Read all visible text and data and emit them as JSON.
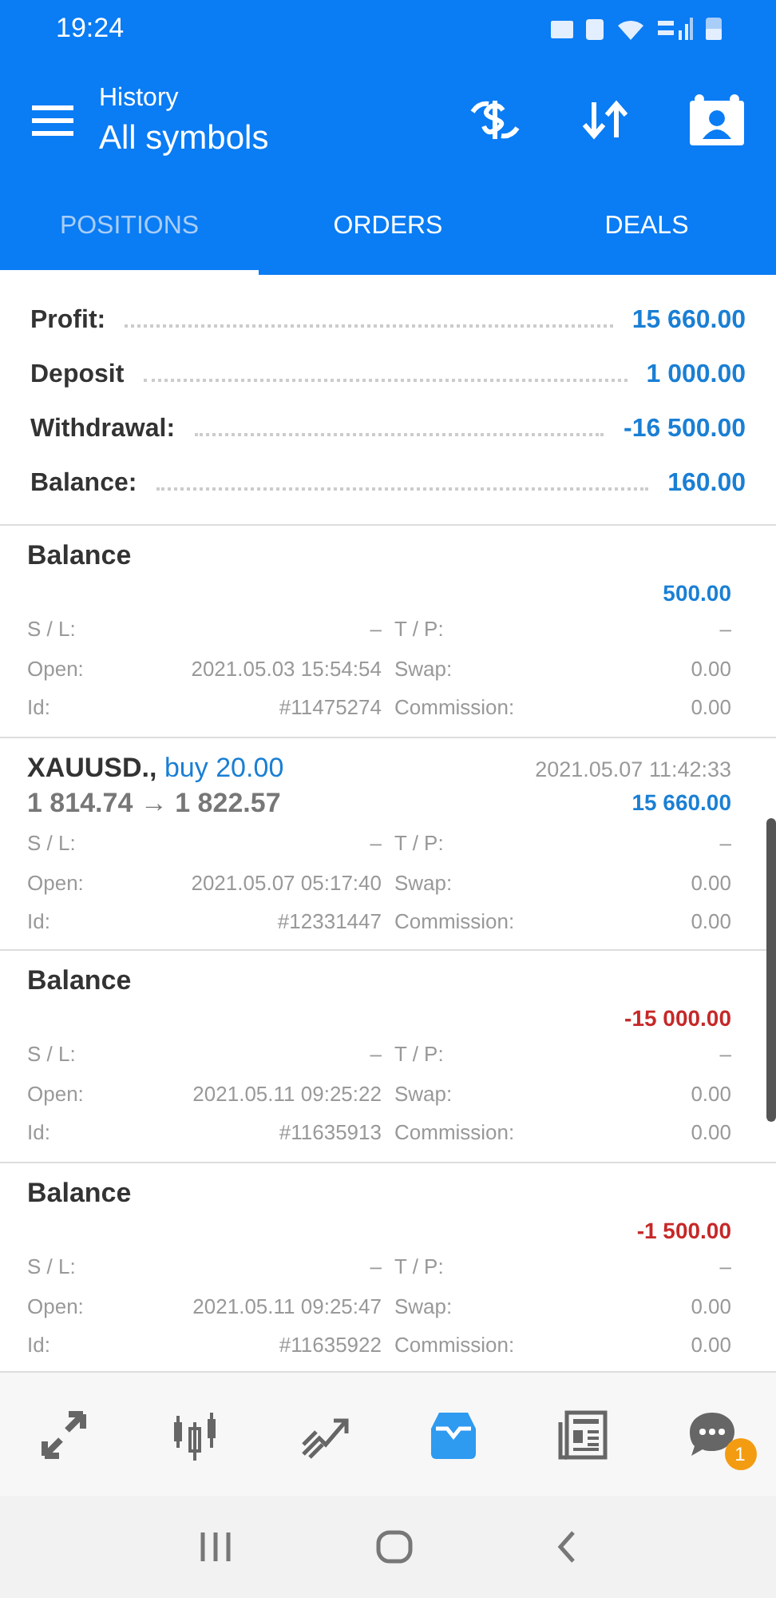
{
  "status_bar": {
    "time": "19:24"
  },
  "toolbar": {
    "subtitle": "History",
    "title": "All symbols"
  },
  "tabs": [
    {
      "label": "POSITIONS",
      "selected": true
    },
    {
      "label": "ORDERS",
      "selected": false
    },
    {
      "label": "DEALS",
      "selected": false
    }
  ],
  "summary": [
    {
      "label": "Profit:",
      "value": "15 660.00"
    },
    {
      "label": "Deposit",
      "value": "1 000.00"
    },
    {
      "label": "Withdrawal:",
      "value": "-16 500.00"
    },
    {
      "label": "Balance:",
      "value": "160.00"
    }
  ],
  "deals": [
    {
      "kind": "balance",
      "title": "Balance",
      "amount": "500.00",
      "color": "#1a7fd4",
      "sl_label": "S / L:",
      "sl": "–",
      "tp_label": "T / P:",
      "tp": "–",
      "open_label": "Open:",
      "open": "2021.05.03 15:54:54",
      "swap_label": "Swap:",
      "swap": "0.00",
      "id_label": "Id:",
      "id": "#11475274",
      "commission_label": "Commission:",
      "commission": "0.00"
    },
    {
      "kind": "trade",
      "title": "XAUUSD.,",
      "side": "buy 20.00",
      "prices": "1 814.74 → 1 822.57",
      "time": "2021.05.07 11:42:33",
      "amount": "15 660.00",
      "color": "#1a7fd4",
      "sl_label": "S / L:",
      "sl": "–",
      "tp_label": "T / P:",
      "tp": "–",
      "open_label": "Open:",
      "open": "2021.05.07 05:17:40",
      "swap_label": "Swap:",
      "swap": "0.00",
      "id_label": "Id:",
      "id": "#12331447",
      "commission_label": "Commission:",
      "commission": "0.00"
    },
    {
      "kind": "balance",
      "title": "Balance",
      "amount": "-15 000.00",
      "color": "#c62828",
      "sl_label": "S / L:",
      "sl": "–",
      "tp_label": "T / P:",
      "tp": "–",
      "open_label": "Open:",
      "open": "2021.05.11 09:25:22",
      "swap_label": "Swap:",
      "swap": "0.00",
      "id_label": "Id:",
      "id": "#11635913",
      "commission_label": "Commission:",
      "commission": "0.00"
    },
    {
      "kind": "balance",
      "title": "Balance",
      "amount": "-1 500.00",
      "color": "#c62828",
      "sl_label": "S / L:",
      "sl": "–",
      "tp_label": "T / P:",
      "tp": "–",
      "open_label": "Open:",
      "open": "2021.05.11 09:25:47",
      "swap_label": "Swap:",
      "swap": "0.00",
      "id_label": "Id:",
      "id": "#11635922",
      "commission_label": "Commission:",
      "commission": "0.00"
    }
  ],
  "bottom_nav": [
    {
      "kind": "quotes",
      "selected": false
    },
    {
      "kind": "chart",
      "selected": false
    },
    {
      "kind": "trade",
      "selected": false
    },
    {
      "kind": "history",
      "selected": true
    },
    {
      "kind": "news",
      "selected": false
    },
    {
      "kind": "chat",
      "selected": false,
      "badge": "1"
    }
  ]
}
